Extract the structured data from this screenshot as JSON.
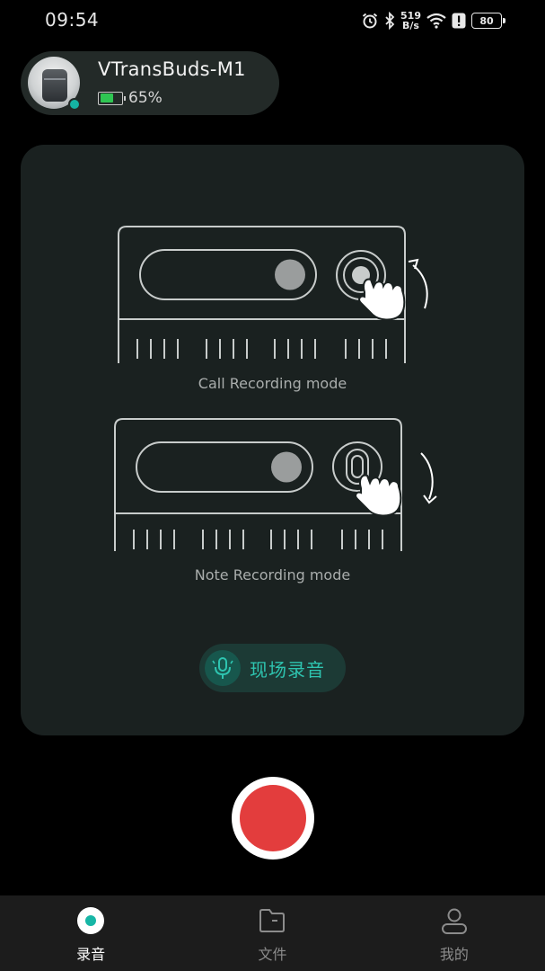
{
  "status_bar": {
    "time": "09:54",
    "net_speed_value": "519",
    "net_speed_unit": "B/s",
    "battery": "80",
    "icons": [
      "alarm-icon",
      "bluetooth-icon",
      "wifi-icon",
      "alert-icon",
      "battery-icon"
    ]
  },
  "device": {
    "name": "VTransBuds-M1",
    "battery_percent": "65%",
    "battery_level": 0.65,
    "battery_color": "#2fc653",
    "status_color": "#15b3a3"
  },
  "illustration": {
    "call_mode_label": "Call Recording mode",
    "note_mode_label": "Note Recording mode"
  },
  "live_button": {
    "label": "现场录音",
    "icon": "mic-icon",
    "accent_color": "#2ec4b0"
  },
  "record_button": {
    "color": "#e33d3d"
  },
  "tabs": [
    {
      "label": "录音",
      "icon": "record-dot-icon",
      "active": true
    },
    {
      "label": "文件",
      "icon": "folder-icon",
      "active": false
    },
    {
      "label": "我的",
      "icon": "profile-icon",
      "active": false
    }
  ]
}
